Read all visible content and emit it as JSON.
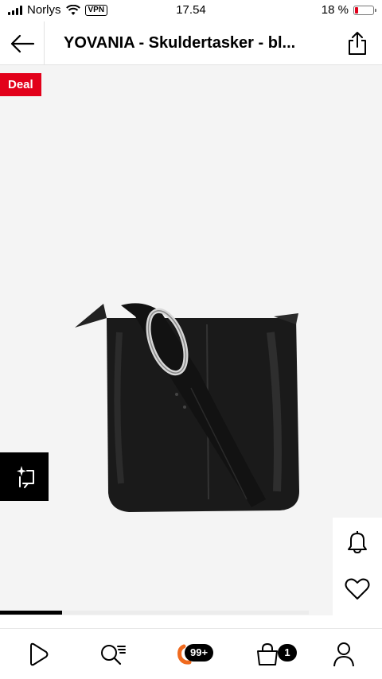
{
  "status_bar": {
    "carrier": "Norlys",
    "vpn": "VPN",
    "time": "17.54",
    "battery_text": "18 %",
    "battery_level": 0.18,
    "battery_color": "#e0001b"
  },
  "header": {
    "title": "YOVANIA - Skuldertasker - bl...",
    "back_icon": "arrow-left-icon",
    "share_icon": "share-icon"
  },
  "product": {
    "deal_label": "Deal",
    "deal_color": "#e2001a",
    "image_progress": 0.2
  },
  "bottom_nav": {
    "items": [
      "play-icon",
      "search-list-icon",
      "chat-icon",
      "basket-icon",
      "profile-icon"
    ],
    "notifications_badge": "99+",
    "basket_badge": "1"
  }
}
